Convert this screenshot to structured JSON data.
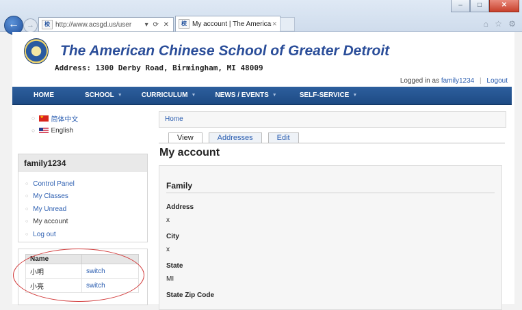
{
  "browser": {
    "url": "http://www.acsgd.us/user",
    "favicon_text": "校",
    "tab_title": "My account | The American...",
    "tab_close": "✕",
    "back_glyph": "←",
    "fwd_glyph": "→",
    "addr_controls": "▾ ⟳ ✕",
    "window_buttons": [
      "–",
      "□",
      "✕"
    ],
    "toolbar_icons": "⌂ ☆ ⚙"
  },
  "site": {
    "name": "The American Chinese School of Greater Detroit",
    "address": "Address: 1300 Derby Road, Birmingham, MI 48009"
  },
  "login": {
    "prefix": "Logged in as",
    "user": "family1234",
    "logout": "Logout"
  },
  "nav": {
    "items": [
      {
        "label": "Home",
        "dropdown": false
      },
      {
        "label": "School",
        "dropdown": true
      },
      {
        "label": "Curriculum",
        "dropdown": true
      },
      {
        "label": "News / Events",
        "dropdown": true
      },
      {
        "label": "Self-Service",
        "dropdown": true
      }
    ],
    "caret": "▼"
  },
  "languages": [
    {
      "label": "简体中文",
      "flag": "cn"
    },
    {
      "label": "English",
      "flag": "us"
    }
  ],
  "user_block": {
    "title": "family1234",
    "menu": [
      {
        "label": "Control Panel",
        "link": true
      },
      {
        "label": "My Classes",
        "link": true
      },
      {
        "label": "My Unread",
        "link": true
      },
      {
        "label": "My account",
        "link": false
      },
      {
        "label": "Log out",
        "link": true
      }
    ],
    "ring": "○"
  },
  "switch_table": {
    "header": "Name",
    "rows": [
      {
        "name": "小明",
        "action": "switch"
      },
      {
        "name": "小亮",
        "action": "switch"
      }
    ]
  },
  "breadcrumb": "Home",
  "page_tabs": [
    "View",
    "Addresses",
    "Edit"
  ],
  "page_title": "My account",
  "family": {
    "heading": "Family",
    "fields": [
      {
        "label": "Address",
        "value": "x"
      },
      {
        "label": "City",
        "value": "x"
      },
      {
        "label": "State",
        "value": "MI"
      },
      {
        "label": "State Zip Code",
        "value": ""
      }
    ]
  },
  "colors": {
    "nav_bg": "#1e4b85",
    "site_title": "#2a4d99",
    "link": "#2a5db0",
    "annotation_oval": "#d23a3a"
  }
}
